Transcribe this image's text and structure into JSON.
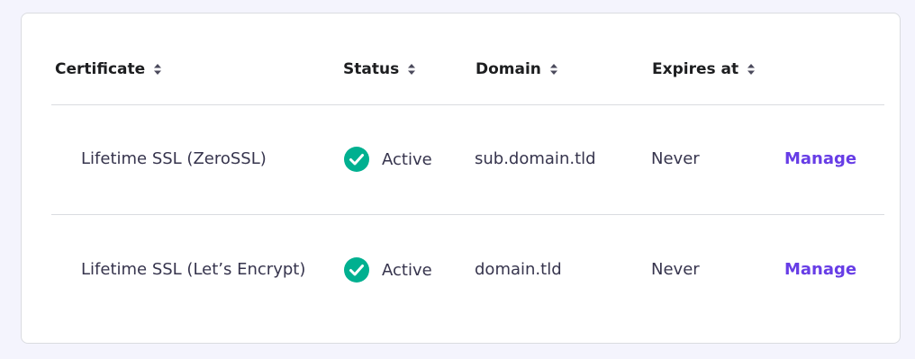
{
  "table": {
    "headers": [
      {
        "label": "Certificate",
        "sort_icon": "sort-updown-icon"
      },
      {
        "label": "Status",
        "sort_icon": "sort-updown-icon"
      },
      {
        "label": "Domain",
        "sort_icon": "sort-updown-icon"
      },
      {
        "label": "Expires at",
        "sort_icon": "sort-updown-icon"
      }
    ],
    "rows": [
      {
        "certificate": "Lifetime SSL (ZeroSSL)",
        "status": "Active",
        "status_icon": "check-circle-icon",
        "domain": "sub.domain.tld",
        "expires": "Never",
        "action": "Manage"
      },
      {
        "certificate": "Lifetime SSL (Let’s Encrypt)",
        "status": "Active",
        "status_icon": "check-circle-icon",
        "domain": "domain.tld",
        "expires": "Never",
        "action": "Manage"
      }
    ]
  },
  "colors": {
    "page_background": "#f4f4fd",
    "card_background": "#ffffff",
    "accent": "#673de6",
    "status_active": "#00b090",
    "header_text": "#1d1e20",
    "body_text": "#36344d",
    "divider": "#dadce0"
  }
}
